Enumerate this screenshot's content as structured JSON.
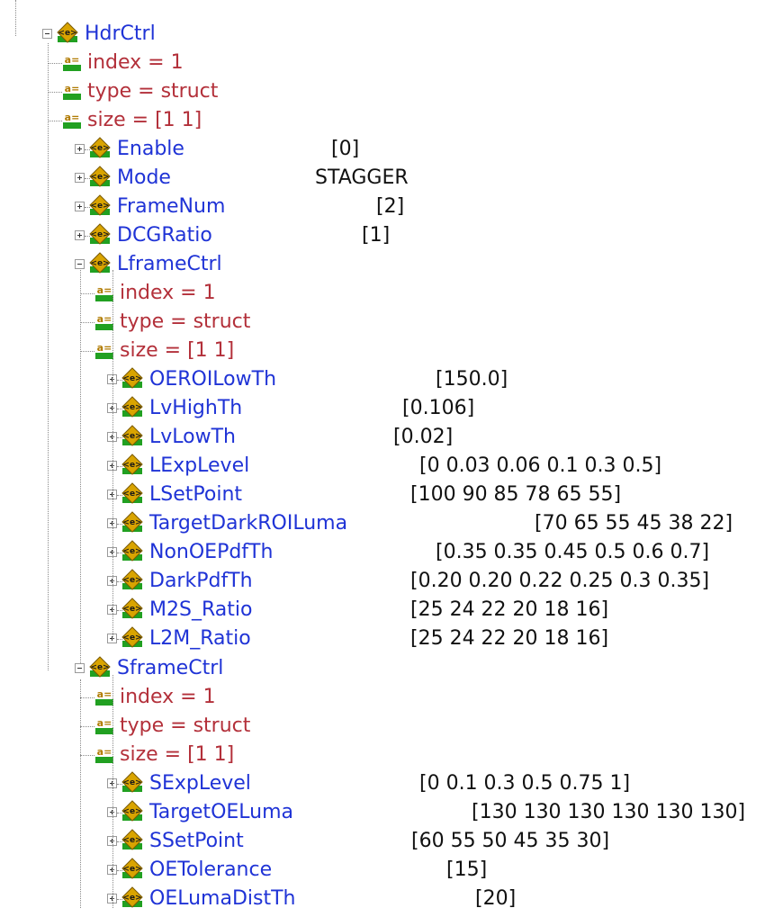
{
  "tree": {
    "hdr_ctrl": {
      "label": "HdrCtrl",
      "attrs": [
        "index = 1",
        "type = struct",
        "size = [1 1]"
      ],
      "children": [
        {
          "label": "Enable",
          "value": "[0]"
        },
        {
          "label": "Mode",
          "value": "STAGGER"
        },
        {
          "label": "FrameNum",
          "value": "[2]"
        },
        {
          "label": "DCGRatio",
          "value": "[1]"
        }
      ]
    },
    "lframe_ctrl": {
      "label": "LframeCtrl",
      "attrs": [
        "index = 1",
        "type = struct",
        "size = [1 1]"
      ],
      "children": [
        {
          "label": "OEROILowTh",
          "value": "[150.0]"
        },
        {
          "label": "LvHighTh",
          "value": "[0.106]"
        },
        {
          "label": "LvLowTh",
          "value": "[0.02]"
        },
        {
          "label": "LExpLevel",
          "value": "[0 0.03 0.06 0.1 0.3 0.5]"
        },
        {
          "label": "LSetPoint",
          "value": "[100 90 85 78 65 55]"
        },
        {
          "label": "TargetDarkROILuma",
          "value": "[70 65 55 45 38 22]"
        },
        {
          "label": "NonOEPdfTh",
          "value": "[0.35 0.35 0.45 0.5 0.6 0.7]"
        },
        {
          "label": "DarkPdfTh",
          "value": "[0.20 0.20 0.22 0.25 0.3 0.35]"
        },
        {
          "label": "M2S_Ratio",
          "value": "[25 24 22 20 18 16]"
        },
        {
          "label": "L2M_Ratio",
          "value": "[25 24 22 20 18 16]"
        }
      ]
    },
    "sframe_ctrl": {
      "label": "SframeCtrl",
      "attrs": [
        "index = 1",
        "type = struct",
        "size = [1 1]"
      ],
      "children": [
        {
          "label": "SExpLevel",
          "value": "[0 0.1 0.3 0.5 0.75 1]"
        },
        {
          "label": "TargetOELuma",
          "value": "[130 130 130 130 130 130]"
        },
        {
          "label": "SSetPoint",
          "value": "[60 55 50 45 35 30]"
        },
        {
          "label": "OETolerance",
          "value": "[15]"
        },
        {
          "label": "OELumaDistTh",
          "value": "[20]"
        }
      ]
    }
  },
  "colors": {
    "element_name": "#1f33d6",
    "attribute_name": "#b3303a",
    "value_text": "#111111",
    "icon_green": "#21a021",
    "icon_gold": "#d9a400"
  },
  "icons": {
    "element": "struct-element-icon",
    "attribute": "attribute-icon",
    "expander_collapsed": "plus-expander-icon",
    "expander_expanded": "minus-expander-icon"
  }
}
